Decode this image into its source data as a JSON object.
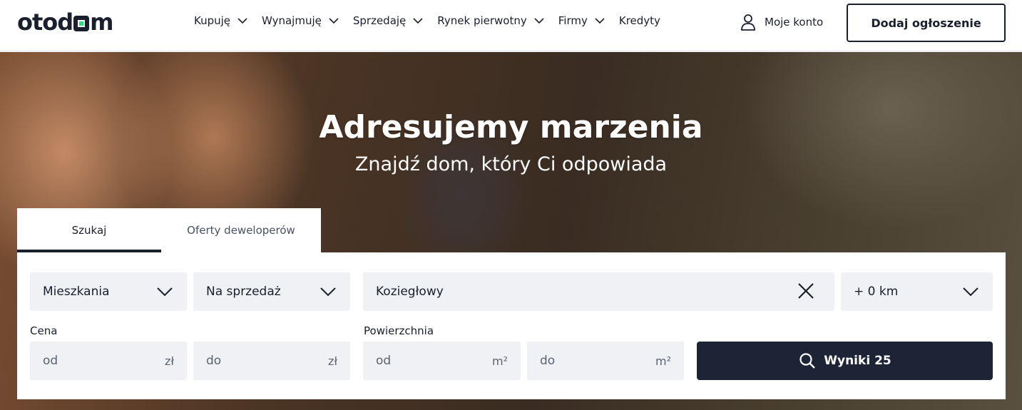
{
  "header": {
    "logo": {
      "part1": "otod",
      "part2": "m"
    },
    "nav": [
      {
        "label": "Kupuję",
        "has_dropdown": true
      },
      {
        "label": "Wynajmuję",
        "has_dropdown": true
      },
      {
        "label": "Sprzedaję",
        "has_dropdown": true
      },
      {
        "label": "Rynek pierwotny",
        "has_dropdown": true
      },
      {
        "label": "Firmy",
        "has_dropdown": true
      },
      {
        "label": "Kredyty",
        "has_dropdown": false
      }
    ],
    "account_label": "Moje konto",
    "add_listing_label": "Dodaj ogłoszenie"
  },
  "hero": {
    "title": "Adresujemy marzenia",
    "subtitle": "Znajdź dom, który Ci odpowiada"
  },
  "tabs": [
    {
      "label": "Szukaj",
      "active": true
    },
    {
      "label": "Oferty deweloperów",
      "active": false
    }
  ],
  "search": {
    "property_type": "Mieszkania",
    "transaction_type": "Na sprzedaż",
    "location": "Koziegłowy",
    "radius": "+ 0 km",
    "price": {
      "label": "Cena",
      "from_placeholder": "od",
      "to_placeholder": "do",
      "unit": "zł"
    },
    "area": {
      "label": "Powierzchnia",
      "from_placeholder": "od",
      "to_placeholder": "do",
      "unit": "m²"
    },
    "results_label": "Wyniki 25"
  },
  "colors": {
    "primary_dark": "#1c2436",
    "field_bg": "#f0f1f4",
    "logo_accent": "#2ddc7b"
  }
}
